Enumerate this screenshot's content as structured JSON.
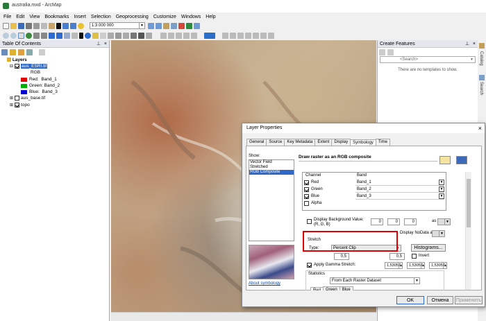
{
  "window": {
    "title": "australia.mxd - ArcMap"
  },
  "menu": [
    "File",
    "Edit",
    "View",
    "Bookmarks",
    "Insert",
    "Selection",
    "Geoprocessing",
    "Customize",
    "Windows",
    "Help"
  ],
  "toolbar": {
    "scale": "1:3 000 000"
  },
  "toc": {
    "title": "Table Of Contents",
    "root": "Layers",
    "layer1": {
      "name": "aus_ESRI.tif",
      "renderer": "RGB",
      "bands": [
        {
          "label": "Red:  Band_1",
          "color": "#e00000"
        },
        {
          "label": "Green: Band_2",
          "color": "#00b000"
        },
        {
          "label": "Blue:  Band_3",
          "color": "#0000d0"
        }
      ]
    },
    "layer2": "aus_base.tif",
    "layer3": "topo"
  },
  "create_features": {
    "title": "Create Features",
    "search_placeholder": "<Search>",
    "empty": "There are no templates to show."
  },
  "side_tabs": [
    "Catalog",
    "Search"
  ],
  "dialog": {
    "title": "Layer Properties",
    "tabs": [
      "General",
      "Source",
      "Key Metadata",
      "Extent",
      "Display",
      "Symbology",
      "Time"
    ],
    "selected_tab": "Symbology",
    "show_label": "Show:",
    "show_items": [
      "Vector Field",
      "Stretched",
      "RGB Composite"
    ],
    "selected_show": "RGB Composite",
    "about_link": "About symbology",
    "heading": "Draw raster as an RGB composite",
    "channel_header": "Channel",
    "band_header": "Band",
    "channels": [
      {
        "name": "Red",
        "band": "Band_1",
        "checked": true
      },
      {
        "name": "Green",
        "band": "Band_2",
        "checked": true
      },
      {
        "name": "Blue",
        "band": "Band_3",
        "checked": true
      },
      {
        "name": "Alpha",
        "band": "",
        "checked": false
      }
    ],
    "bg_label": "Display Background Value:(R, G, B)",
    "bg_values": [
      "0",
      "0",
      "0"
    ],
    "as_label": "as",
    "nodata_label": "Display NoData as",
    "stretch_label": "Stretch",
    "type_label": "Type:",
    "type_value": "Percent Clip",
    "histograms_btn": "Histograms...",
    "stretch_values": [
      "0,5",
      "0,5"
    ],
    "invert_label": "Invert",
    "gamma_label": "Apply Gamma Stretch:",
    "gamma_values": [
      "1,53057",
      "1,53057",
      "1,53057"
    ],
    "stats_label": "Statistics",
    "stats_value": "From Each Raster Dataset",
    "stats_tabs": [
      "Red",
      "Green",
      "Blue"
    ],
    "ok": "OK",
    "cancel": "Отмена",
    "apply": "Применить"
  }
}
